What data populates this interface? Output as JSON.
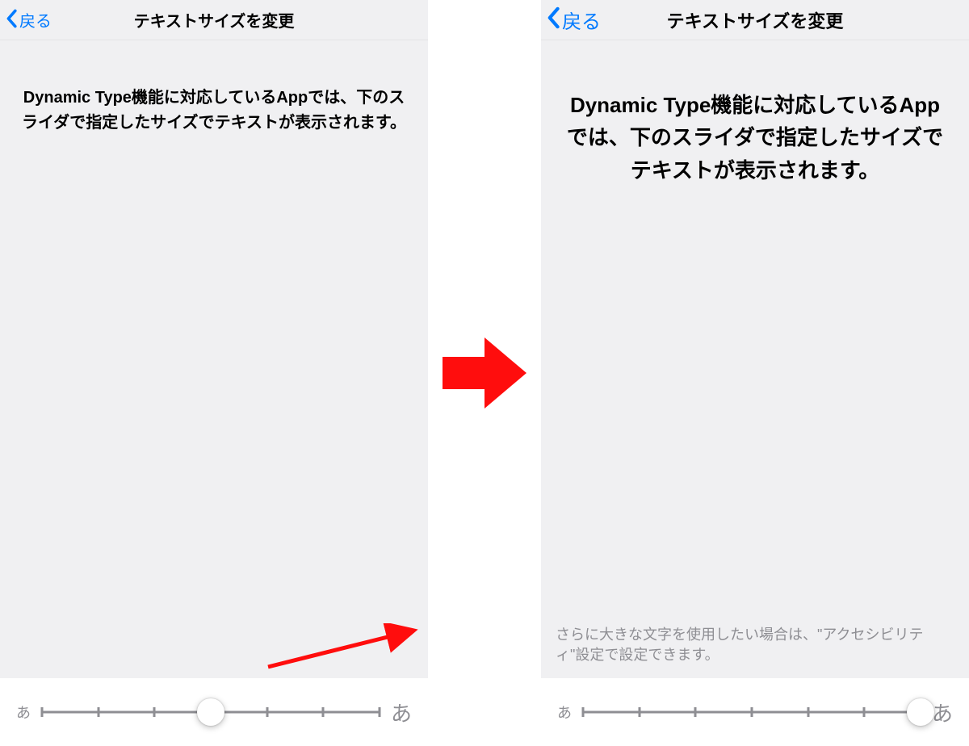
{
  "left": {
    "back_label": "戻る",
    "title": "テキストサイズを変更",
    "description": "Dynamic Type機能に対応しているAppでは、下のスライダで指定したサイズでテキストが表示されます。",
    "slider": {
      "small_char": "あ",
      "big_char": "あ",
      "steps": 7,
      "position_index": 3
    }
  },
  "right": {
    "back_label": "戻る",
    "title": "テキストサイズを変更",
    "description": "Dynamic Type機能に対応しているAppでは、下のスライダで指定したサイズでテキストが表示されます。",
    "footer_note": "さらに大きな文字を使用したい場合は、\"アクセシビリティ\"設定で設定できます。",
    "slider": {
      "small_char": "あ",
      "big_char": "あ",
      "steps": 7,
      "position_index": 6
    }
  },
  "colors": {
    "accent": "#007aff",
    "arrow": "#ff0d0d"
  }
}
